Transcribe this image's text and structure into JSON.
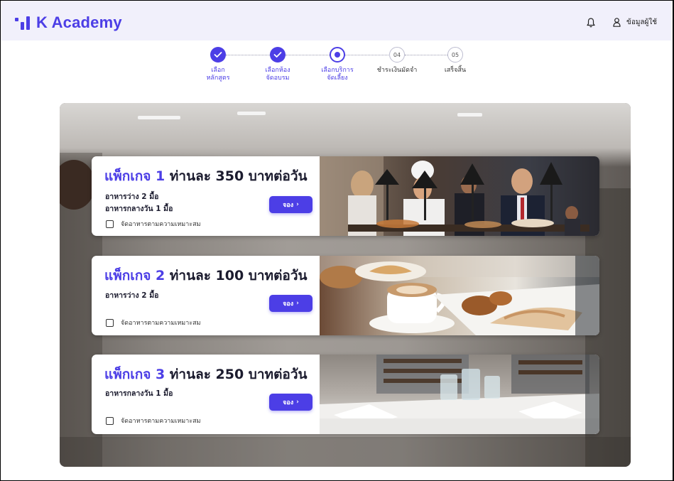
{
  "app": {
    "name": "K Academy",
    "brand_color": "#4c3ee6"
  },
  "header": {
    "notification_icon": "bell-icon",
    "user_icon": "user-icon",
    "user_label": "ข้อมูลผู้ใช้"
  },
  "stepper": {
    "steps": [
      {
        "label_1": "เลือก",
        "label_2": "หลักสูตร",
        "state": "done"
      },
      {
        "label_1": "เลือกห้อง",
        "label_2": "จัดอบรม",
        "state": "done"
      },
      {
        "label_1": "เลือกบริการ",
        "label_2": "จัดเลี้ยง",
        "state": "current"
      },
      {
        "number": "04",
        "label_1": "ชำระเงินมัดจำ",
        "label_2": "",
        "state": "todo"
      },
      {
        "number": "05",
        "label_1": "เสร็จสิ้น",
        "label_2": "",
        "state": "todo"
      }
    ]
  },
  "packages": [
    {
      "title_prefix": "แพ็กเกจ",
      "number": "1",
      "price_text": "ท่านละ 350 บาทต่อวัน",
      "meals": [
        "อาหารว่าง 2 มื้อ",
        "อาหารกลางวัน 1 มื้อ"
      ],
      "book_label": "จอง",
      "checkbox_label": "จัดอาหารตามความเหมาะสม",
      "checked": false
    },
    {
      "title_prefix": "แพ็กเกจ",
      "number": "2",
      "price_text": "ท่านละ 100 บาทต่อวัน",
      "meals": [
        "อาหารว่าง 2 มื้อ"
      ],
      "book_label": "จอง",
      "checkbox_label": "จัดอาหารตามความเหมาะสม",
      "checked": false
    },
    {
      "title_prefix": "แพ็กเกจ",
      "number": "3",
      "price_text": "ท่านละ 250 บาทต่อวัน",
      "meals": [
        "อาหารกลางวัน 1 มื้อ"
      ],
      "book_label": "จอง",
      "checkbox_label": "จัดอาหารตามความเหมาะสม",
      "checked": false
    }
  ]
}
